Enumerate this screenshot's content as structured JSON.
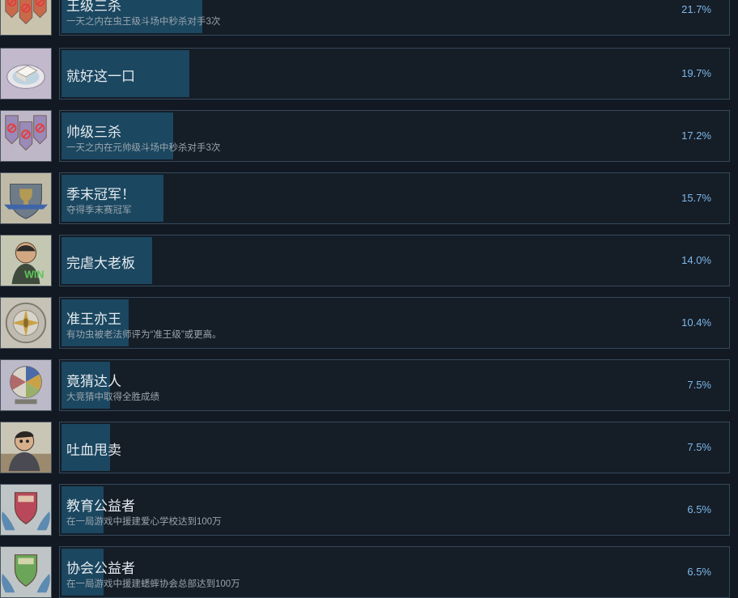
{
  "achievements": [
    {
      "title": "王级三杀",
      "desc": "一天之内在虫王级斗场中秒杀对手3次",
      "percent": "21.7%",
      "fill": 0.217,
      "icon": "red-banners-icon"
    },
    {
      "title": "就好这一口",
      "desc": "",
      "percent": "19.7%",
      "fill": 0.197,
      "icon": "tofu-plate-icon"
    },
    {
      "title": "帅级三杀",
      "desc": "一天之内在元帅级斗场中秒杀对手3次",
      "percent": "17.2%",
      "fill": 0.172,
      "icon": "purple-banners-icon"
    },
    {
      "title": "季末冠军！",
      "desc": "夺得季末赛冠军",
      "percent": "15.7%",
      "fill": 0.157,
      "icon": "trophy-shield-icon"
    },
    {
      "title": "完虐大老板",
      "desc": "",
      "percent": "14.0%",
      "fill": 0.14,
      "icon": "boss-win-icon"
    },
    {
      "title": "准王亦王",
      "desc": "有功虫被老法师评为“准王级”或更高。",
      "percent": "10.4%",
      "fill": 0.104,
      "icon": "cricket-medallion-icon"
    },
    {
      "title": "竟猜达人",
      "desc": "大竞猜中取得全胜成绩",
      "percent": "7.5%",
      "fill": 0.075,
      "icon": "wheel-icon"
    },
    {
      "title": "吐血甩卖",
      "desc": "",
      "percent": "7.5%",
      "fill": 0.075,
      "icon": "shocked-man-icon"
    },
    {
      "title": "教育公益者",
      "desc": "在一局游戏中援建爱心学校达到100万",
      "percent": "6.5%",
      "fill": 0.065,
      "icon": "hands-shield-red-icon"
    },
    {
      "title": "协会公益者",
      "desc": "在一局游戏中援建蟋蟀协会总部达到100万",
      "percent": "6.5%",
      "fill": 0.065,
      "icon": "hands-shield-green-icon"
    }
  ]
}
